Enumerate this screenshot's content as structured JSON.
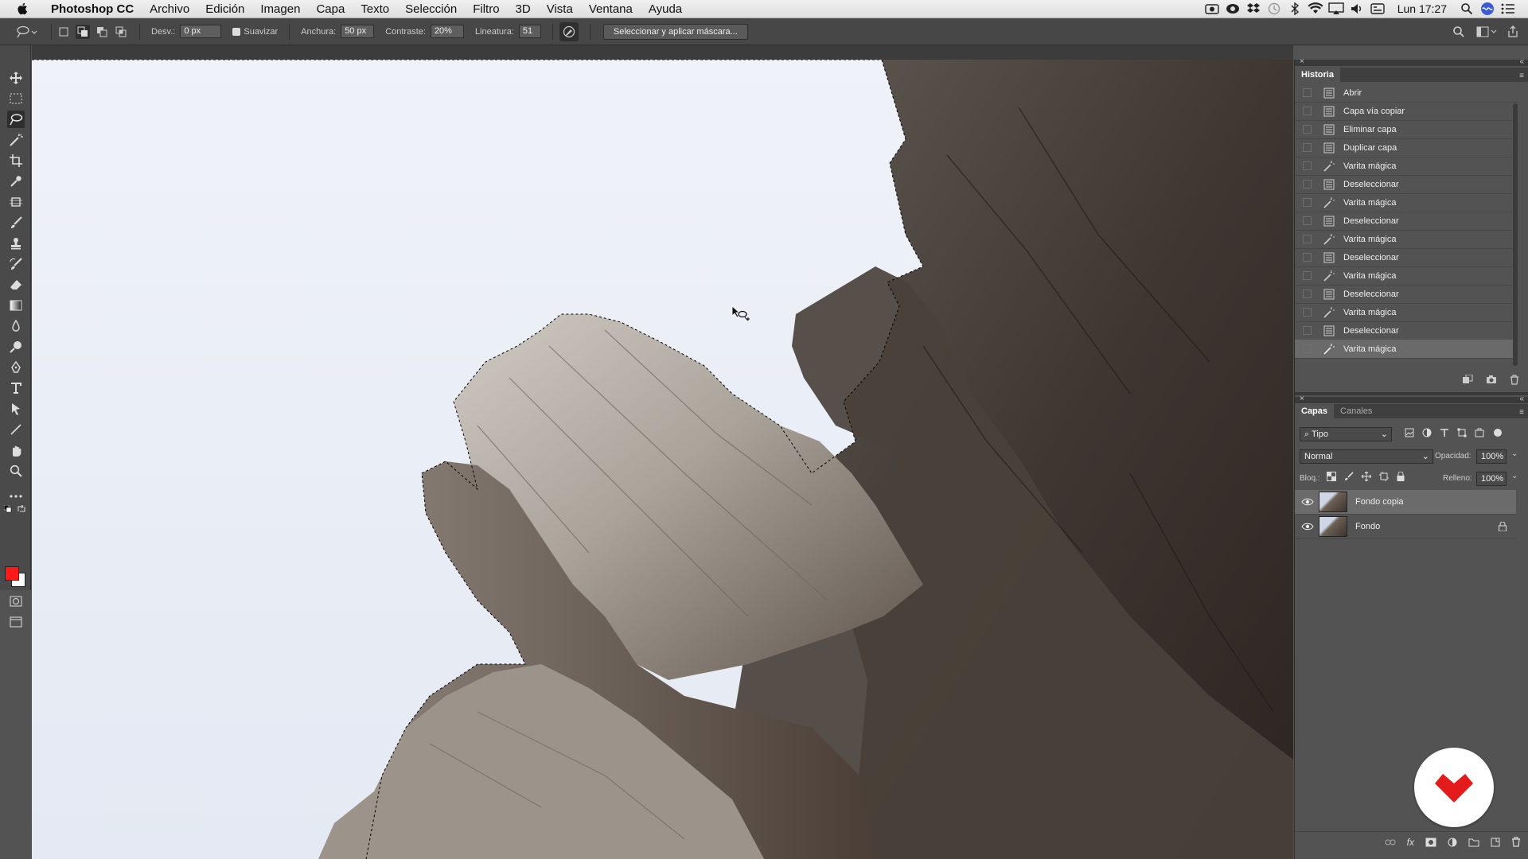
{
  "menubar": {
    "app_name": "Photoshop CC",
    "menus": [
      "Archivo",
      "Edición",
      "Imagen",
      "Capa",
      "Texto",
      "Selección",
      "Filtro",
      "3D",
      "Vista",
      "Ventana",
      "Ayuda"
    ],
    "clock": "Lun 17:27"
  },
  "options": {
    "feather_label": "Desv.:",
    "feather_value": "0 px",
    "antialias_label": "Suavizar",
    "width_label": "Anchura:",
    "width_value": "50 px",
    "contrast_label": "Contraste:",
    "contrast_value": "20%",
    "frequency_label": "Lineatura:",
    "frequency_value": "51",
    "select_mask_button": "Seleccionar y aplicar máscara..."
  },
  "colors": {
    "foreground": "#ff1a1a",
    "background": "#ffffff"
  },
  "history": {
    "tab": "Historia",
    "items": [
      {
        "label": "Abrir",
        "icon": "document-icon"
      },
      {
        "label": "Capa vía copiar",
        "icon": "document-icon"
      },
      {
        "label": "Eliminar capa",
        "icon": "document-icon"
      },
      {
        "label": "Duplicar capa",
        "icon": "document-icon"
      },
      {
        "label": "Varita mágica",
        "icon": "magic-wand-icon"
      },
      {
        "label": "Deseleccionar",
        "icon": "document-icon"
      },
      {
        "label": "Varita mágica",
        "icon": "magic-wand-icon"
      },
      {
        "label": "Deseleccionar",
        "icon": "document-icon"
      },
      {
        "label": "Varita mágica",
        "icon": "magic-wand-icon"
      },
      {
        "label": "Deseleccionar",
        "icon": "document-icon"
      },
      {
        "label": "Varita mágica",
        "icon": "magic-wand-icon"
      },
      {
        "label": "Deseleccionar",
        "icon": "document-icon"
      },
      {
        "label": "Varita mágica",
        "icon": "magic-wand-icon"
      },
      {
        "label": "Deseleccionar",
        "icon": "document-icon"
      },
      {
        "label": "Varita mágica",
        "icon": "magic-wand-icon",
        "selected": true
      }
    ]
  },
  "layers": {
    "tab_layers": "Capas",
    "tab_channels": "Canales",
    "filter_kind": "Tipo",
    "blend_mode": "Normal",
    "opacity_label": "Opacidad:",
    "opacity_value": "100%",
    "lock_label": "Bloq.:",
    "fill_label": "Relleno:",
    "fill_value": "100%",
    "items": [
      {
        "name": "Fondo copia",
        "visible": true,
        "selected": true,
        "locked": false
      },
      {
        "name": "Fondo",
        "visible": true,
        "selected": false,
        "locked": true
      }
    ]
  }
}
